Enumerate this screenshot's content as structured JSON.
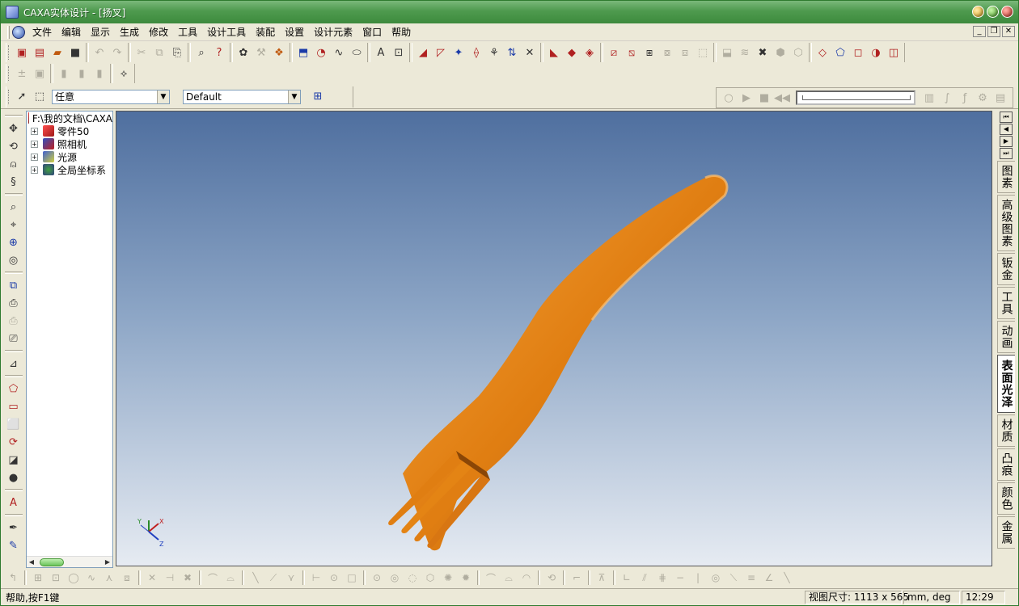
{
  "window": {
    "title": "CAXA实体设计 - [扬叉]"
  },
  "menu": {
    "items": [
      "文件",
      "编辑",
      "显示",
      "生成",
      "修改",
      "工具",
      "设计工具",
      "装配",
      "设置",
      "设计元素",
      "窗口",
      "帮助"
    ]
  },
  "mdi": {
    "minimize": "_",
    "restore": "❐",
    "close": "✕"
  },
  "toolbar": {
    "selection_mode_value": "任意",
    "view_style_value": "Default"
  },
  "tree": {
    "root": "F:\\我的文档\\CAXA",
    "items": [
      {
        "label": "零件50",
        "icon": "part-icon"
      },
      {
        "label": "照相机",
        "icon": "camera-icon"
      },
      {
        "label": "光源",
        "icon": "light-icon"
      },
      {
        "label": "全局坐标系",
        "icon": "coordinate-system-icon"
      }
    ]
  },
  "triad": {
    "x": "X",
    "y": "Y",
    "z": "Z"
  },
  "right_tabs": [
    "图素",
    "高级图素",
    "钣金",
    "工具",
    "动画",
    "表面光泽",
    "材质",
    "凸痕",
    "颜色",
    "金属"
  ],
  "right_tabs_active": "表面光泽",
  "status": {
    "help": "帮助,按F1键",
    "viewport_size": "视图尺寸: 1113 x  565",
    "units": "mm, deg",
    "time": "12:29"
  },
  "colors": {
    "fork": "#e07e12",
    "fork_highlight": "#f7a43a",
    "fork_shadow": "#9c4f06",
    "title_green": "#4e9a4e"
  }
}
